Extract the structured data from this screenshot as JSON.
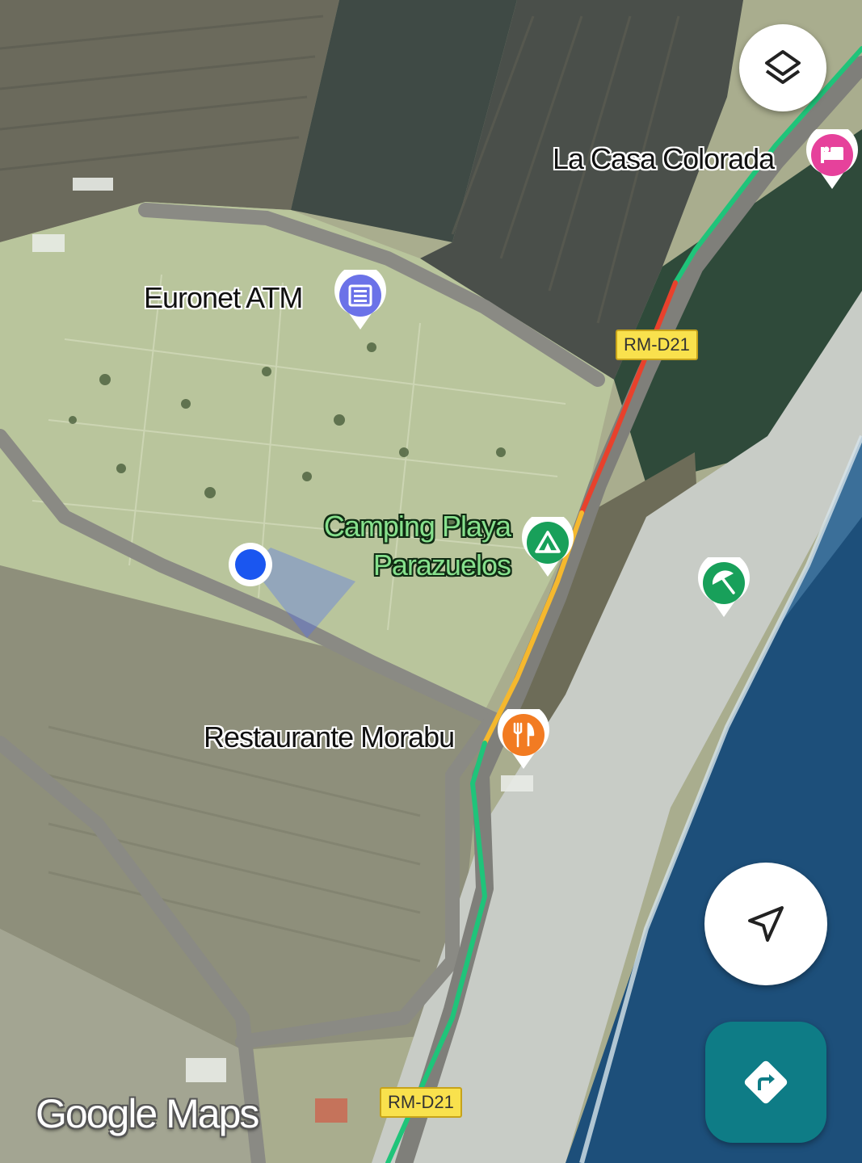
{
  "map": {
    "places": {
      "la_casa_colorada": "La Casa Colorada",
      "euronet_atm": "Euronet ATM",
      "camping_line1": "Camping Playa",
      "camping_line2": "Parazuelos",
      "restaurante": "Restaurante Morabu"
    },
    "road_refs": {
      "top": "RM-D21",
      "bottom": "RM-D21"
    },
    "traffic_colors": {
      "free": "#1fc47a",
      "slow": "#f5b82e",
      "heavy": "#e8412c"
    },
    "poi_colors": {
      "lodging": "#e6419b",
      "atm": "#6b72e8",
      "camping": "#18a05a",
      "beach": "#18a05a",
      "restaurant": "#f27b22"
    },
    "icons": [
      "layers-icon",
      "lodging-icon",
      "atm-icon",
      "camping-icon",
      "beach-icon",
      "restaurant-icon",
      "my-location-icon",
      "directions-icon"
    ]
  },
  "branding": {
    "logo_text": "Google Maps"
  }
}
